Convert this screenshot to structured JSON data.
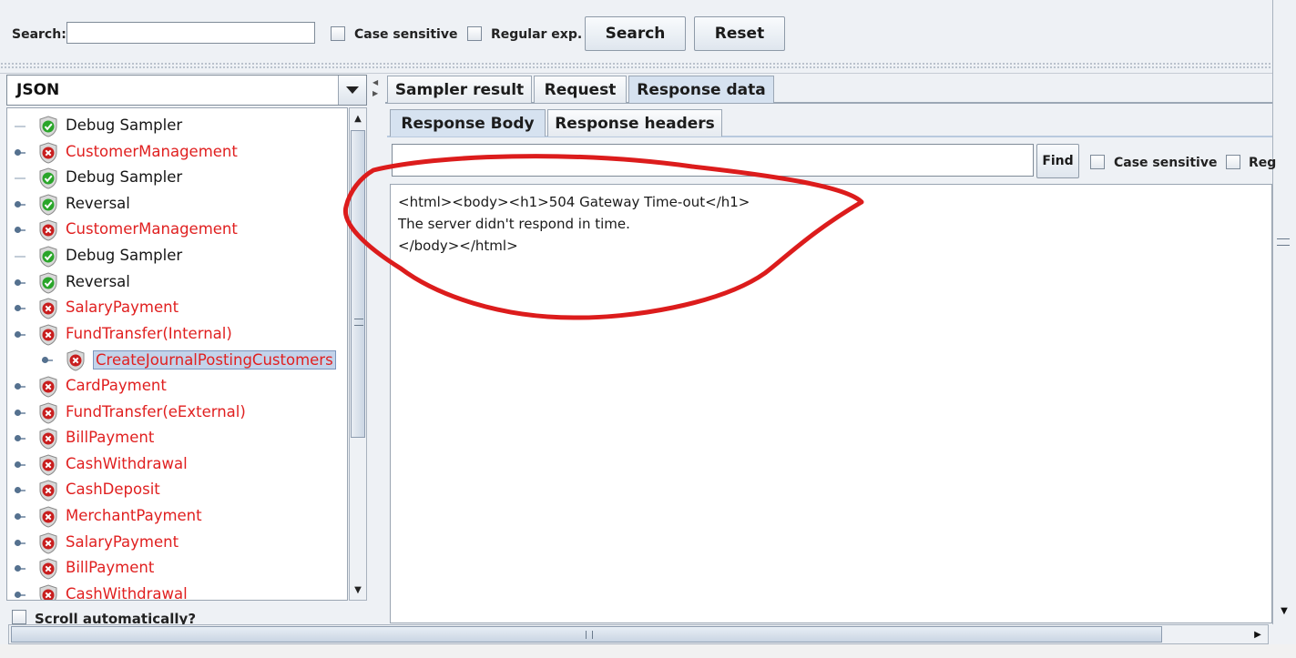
{
  "search": {
    "label": "Search:",
    "value": "",
    "case_sensitive_label": "Case sensitive",
    "regex_label": "Regular exp.",
    "search_button": "Search",
    "reset_button": "Reset"
  },
  "left": {
    "renderer": "JSON",
    "tree": [
      {
        "label": "Debug Sampler",
        "status": "ok",
        "expandable": false,
        "indent": 0
      },
      {
        "label": "CustomerManagement",
        "status": "error",
        "expandable": true,
        "indent": 0
      },
      {
        "label": "Debug Sampler",
        "status": "ok",
        "expandable": false,
        "indent": 0
      },
      {
        "label": "Reversal",
        "status": "ok",
        "expandable": true,
        "indent": 0
      },
      {
        "label": "CustomerManagement",
        "status": "error",
        "expandable": true,
        "indent": 0
      },
      {
        "label": "Debug Sampler",
        "status": "ok",
        "expandable": false,
        "indent": 0
      },
      {
        "label": "Reversal",
        "status": "ok",
        "expandable": true,
        "indent": 0
      },
      {
        "label": "SalaryPayment",
        "status": "error",
        "expandable": true,
        "indent": 0
      },
      {
        "label": "FundTransfer(Internal)",
        "status": "error",
        "expandable": true,
        "expanded": true,
        "indent": 0
      },
      {
        "label": "CreateJournalPostingCustomers",
        "status": "error",
        "expandable": true,
        "indent": 1,
        "selected": true
      },
      {
        "label": "CardPayment",
        "status": "error",
        "expandable": true,
        "indent": 0
      },
      {
        "label": "FundTransfer(eExternal)",
        "status": "error",
        "expandable": true,
        "indent": 0
      },
      {
        "label": "BillPayment",
        "status": "error",
        "expandable": true,
        "indent": 0
      },
      {
        "label": "CashWithdrawal",
        "status": "error",
        "expandable": true,
        "indent": 0
      },
      {
        "label": "CashDeposit",
        "status": "error",
        "expandable": true,
        "indent": 0
      },
      {
        "label": "MerchantPayment",
        "status": "error",
        "expandable": true,
        "indent": 0
      },
      {
        "label": "SalaryPayment",
        "status": "error",
        "expandable": true,
        "indent": 0
      },
      {
        "label": "BillPayment",
        "status": "error",
        "expandable": true,
        "indent": 0
      },
      {
        "label": "CashWithdrawal",
        "status": "error",
        "expandable": true,
        "indent": 0
      }
    ],
    "scroll_auto_label": "Scroll automatically?"
  },
  "right": {
    "tabs": [
      "Sampler result",
      "Request",
      "Response data"
    ],
    "active_tab": "Response data",
    "subtabs": [
      "Response Body",
      "Response headers"
    ],
    "active_subtab": "Response Body",
    "find": {
      "value": "",
      "button": "Find",
      "case_sensitive_label": "Case sensitive",
      "regex_label": "Reg"
    },
    "response_lines": [
      "<html><body><h1>504 Gateway Time-out</h1>",
      "The server didn't respond in time.",
      "</body></html>"
    ]
  },
  "colors": {
    "error_text": "#e02020",
    "ok_shield": "#2aa52a",
    "error_shield": "#c81e1e",
    "annotation": "#dc1c1c",
    "selection": "#c3d3ea"
  }
}
